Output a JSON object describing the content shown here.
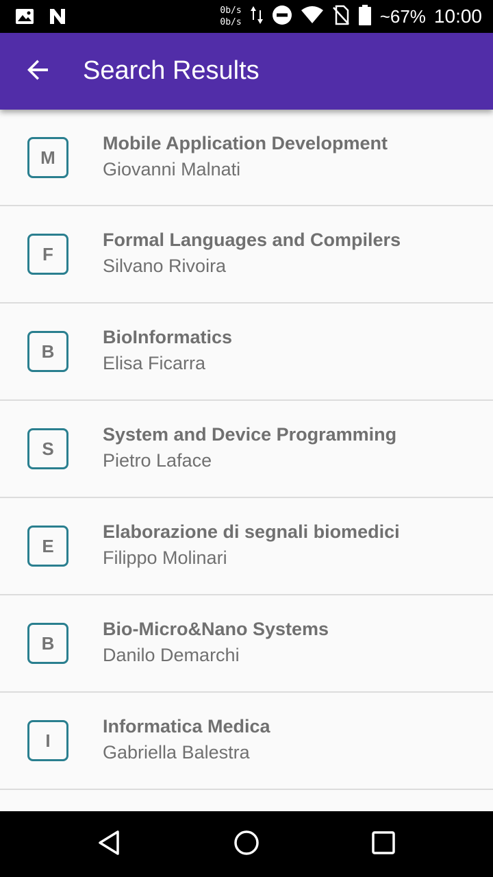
{
  "status_bar": {
    "net_up": "0b/s",
    "net_down": "0b/s",
    "battery": "~67%",
    "time": "10:00",
    "icons": [
      "image-icon",
      "n-app-icon",
      "data-arrows-icon",
      "do-not-disturb-icon",
      "wifi-icon",
      "no-sim-icon",
      "battery-icon"
    ]
  },
  "app_bar": {
    "title": "Search Results",
    "back_icon": "arrow-back-icon",
    "color": "#512da8"
  },
  "results": [
    {
      "letter": "M",
      "title": "Mobile Application Development",
      "teacher": "Giovanni Malnati"
    },
    {
      "letter": "F",
      "title": "Formal Languages and Compilers",
      "teacher": "Silvano Rivoira"
    },
    {
      "letter": "B",
      "title": "BioInformatics",
      "teacher": "Elisa Ficarra"
    },
    {
      "letter": "S",
      "title": "System and Device Programming",
      "teacher": "Pietro Laface"
    },
    {
      "letter": "E",
      "title": "Elaborazione di segnali biomedici",
      "teacher": "Filippo Molinari"
    },
    {
      "letter": "B",
      "title": "Bio-Micro&Nano Systems",
      "teacher": "Danilo Demarchi"
    },
    {
      "letter": "I",
      "title": "Informatica Medica",
      "teacher": "Gabriella Balestra"
    }
  ],
  "nav_bar": {
    "icons": [
      "back-triangle-icon",
      "home-circle-icon",
      "recents-square-icon"
    ]
  },
  "colors": {
    "accent": "#512da8",
    "avatar_border": "#2a7f8f",
    "text": "#707070"
  }
}
